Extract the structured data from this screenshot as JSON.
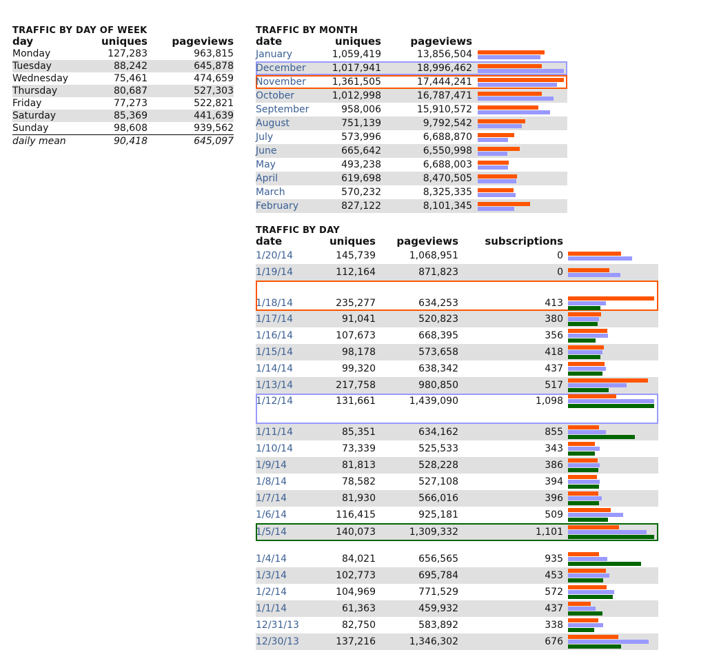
{
  "colors": {
    "uniques": "#ff5500",
    "pageviews": "#9999ff",
    "subscriptions": "#006600",
    "stripe": "#e0e0e0",
    "link": "#3a5f94"
  },
  "week": {
    "title": "TRAFFIC BY DAY OF WEEK",
    "headers": [
      "day",
      "uniques",
      "pageviews"
    ],
    "rows": [
      {
        "day": "Monday",
        "uniques": "127,283",
        "pageviews": "963,815"
      },
      {
        "day": "Tuesday",
        "uniques": "88,242",
        "pageviews": "645,878"
      },
      {
        "day": "Wednesday",
        "uniques": "75,461",
        "pageviews": "474,659"
      },
      {
        "day": "Thursday",
        "uniques": "80,687",
        "pageviews": "527,303"
      },
      {
        "day": "Friday",
        "uniques": "77,273",
        "pageviews": "522,821"
      },
      {
        "day": "Saturday",
        "uniques": "85,369",
        "pageviews": "441,639"
      },
      {
        "day": "Sunday",
        "uniques": "98,608",
        "pageviews": "939,562"
      }
    ],
    "mean": {
      "label": "daily mean",
      "uniques": "90,418",
      "pageviews": "645,097"
    }
  },
  "month": {
    "title": "TRAFFIC BY MONTH",
    "headers": [
      "date",
      "uniques",
      "pageviews"
    ],
    "max": {
      "uniques": 1361505,
      "pageviews": 18996462
    },
    "rows": [
      {
        "date": "January",
        "uniques": "1,059,419",
        "pageviews": "13,856,504",
        "u": 1059419,
        "p": 13856504
      },
      {
        "date": "December",
        "uniques": "1,017,941",
        "pageviews": "18,996,462",
        "u": 1017941,
        "p": 18996462,
        "highlight": "blue"
      },
      {
        "date": "November",
        "uniques": "1,361,505",
        "pageviews": "17,444,241",
        "u": 1361505,
        "p": 17444241,
        "highlight": "orange"
      },
      {
        "date": "October",
        "uniques": "1,012,998",
        "pageviews": "16,787,471",
        "u": 1012998,
        "p": 16787471
      },
      {
        "date": "September",
        "uniques": "958,006",
        "pageviews": "15,910,572",
        "u": 958006,
        "p": 15910572
      },
      {
        "date": "August",
        "uniques": "751,139",
        "pageviews": "9,792,542",
        "u": 751139,
        "p": 9792542
      },
      {
        "date": "July",
        "uniques": "573,996",
        "pageviews": "6,688,870",
        "u": 573996,
        "p": 6688870
      },
      {
        "date": "June",
        "uniques": "665,642",
        "pageviews": "6,550,998",
        "u": 665642,
        "p": 6550998
      },
      {
        "date": "May",
        "uniques": "493,238",
        "pageviews": "6,688,003",
        "u": 493238,
        "p": 6688003
      },
      {
        "date": "April",
        "uniques": "619,698",
        "pageviews": "8,470,505",
        "u": 619698,
        "p": 8470505
      },
      {
        "date": "March",
        "uniques": "570,232",
        "pageviews": "8,325,335",
        "u": 570232,
        "p": 8325335
      },
      {
        "date": "February",
        "uniques": "827,122",
        "pageviews": "8,101,345",
        "u": 827122,
        "p": 8101345
      }
    ]
  },
  "day": {
    "title": "TRAFFIC BY DAY",
    "headers": [
      "date",
      "uniques",
      "pageviews",
      "subscriptions"
    ],
    "max": {
      "uniques": 235277,
      "pageviews": 1439090,
      "subscriptions": 1101
    },
    "rows": [
      {
        "date": "1/20/14",
        "uniques": "145,739",
        "pageviews": "1,068,951",
        "subscriptions": "0",
        "u": 145739,
        "p": 1068951,
        "s": 0
      },
      {
        "date": "1/19/14",
        "uniques": "112,164",
        "pageviews": "871,823",
        "subscriptions": "0",
        "u": 112164,
        "p": 871823,
        "s": 0
      },
      {
        "date": "1/18/14",
        "uniques": "235,277",
        "pageviews": "634,253",
        "subscriptions": "413",
        "u": 235277,
        "p": 634253,
        "s": 413,
        "highlight": "orange"
      },
      {
        "date": "1/17/14",
        "uniques": "91,041",
        "pageviews": "520,823",
        "subscriptions": "380",
        "u": 91041,
        "p": 520823,
        "s": 380
      },
      {
        "date": "1/16/14",
        "uniques": "107,673",
        "pageviews": "668,395",
        "subscriptions": "356",
        "u": 107673,
        "p": 668395,
        "s": 356
      },
      {
        "date": "1/15/14",
        "uniques": "98,178",
        "pageviews": "573,658",
        "subscriptions": "418",
        "u": 98178,
        "p": 573658,
        "s": 418
      },
      {
        "date": "1/14/14",
        "uniques": "99,320",
        "pageviews": "638,342",
        "subscriptions": "437",
        "u": 99320,
        "p": 638342,
        "s": 437
      },
      {
        "date": "1/13/14",
        "uniques": "217,758",
        "pageviews": "980,850",
        "subscriptions": "517",
        "u": 217758,
        "p": 980850,
        "s": 517
      },
      {
        "date": "1/12/14",
        "uniques": "131,661",
        "pageviews": "1,439,090",
        "subscriptions": "1,098",
        "u": 131661,
        "p": 1439090,
        "s": 1098,
        "highlight": "blue"
      },
      {
        "date": "1/11/14",
        "uniques": "85,351",
        "pageviews": "634,162",
        "subscriptions": "855",
        "u": 85351,
        "p": 634162,
        "s": 855
      },
      {
        "date": "1/10/14",
        "uniques": "73,339",
        "pageviews": "525,533",
        "subscriptions": "343",
        "u": 73339,
        "p": 525533,
        "s": 343
      },
      {
        "date": "1/9/14",
        "uniques": "81,813",
        "pageviews": "528,228",
        "subscriptions": "386",
        "u": 81813,
        "p": 528228,
        "s": 386
      },
      {
        "date": "1/8/14",
        "uniques": "78,582",
        "pageviews": "527,108",
        "subscriptions": "394",
        "u": 78582,
        "p": 527108,
        "s": 394
      },
      {
        "date": "1/7/14",
        "uniques": "81,930",
        "pageviews": "566,016",
        "subscriptions": "396",
        "u": 81930,
        "p": 566016,
        "s": 396
      },
      {
        "date": "1/6/14",
        "uniques": "116,415",
        "pageviews": "925,181",
        "subscriptions": "509",
        "u": 116415,
        "p": 925181,
        "s": 509
      },
      {
        "date": "1/5/14",
        "uniques": "140,073",
        "pageviews": "1,309,332",
        "subscriptions": "1,101",
        "u": 140073,
        "p": 1309332,
        "s": 1101,
        "highlight": "green"
      },
      {
        "date": "1/4/14",
        "uniques": "84,021",
        "pageviews": "656,565",
        "subscriptions": "935",
        "u": 84021,
        "p": 656565,
        "s": 935
      },
      {
        "date": "1/3/14",
        "uniques": "102,773",
        "pageviews": "695,784",
        "subscriptions": "453",
        "u": 102773,
        "p": 695784,
        "s": 453
      },
      {
        "date": "1/2/14",
        "uniques": "104,969",
        "pageviews": "771,529",
        "subscriptions": "572",
        "u": 104969,
        "p": 771529,
        "s": 572
      },
      {
        "date": "1/1/14",
        "uniques": "61,363",
        "pageviews": "459,932",
        "subscriptions": "437",
        "u": 61363,
        "p": 459932,
        "s": 437
      },
      {
        "date": "12/31/13",
        "uniques": "82,750",
        "pageviews": "583,892",
        "subscriptions": "338",
        "u": 82750,
        "p": 583892,
        "s": 338
      },
      {
        "date": "12/30/13",
        "uniques": "137,216",
        "pageviews": "1,346,302",
        "subscriptions": "676",
        "u": 137216,
        "p": 1346302,
        "s": 676
      }
    ]
  }
}
